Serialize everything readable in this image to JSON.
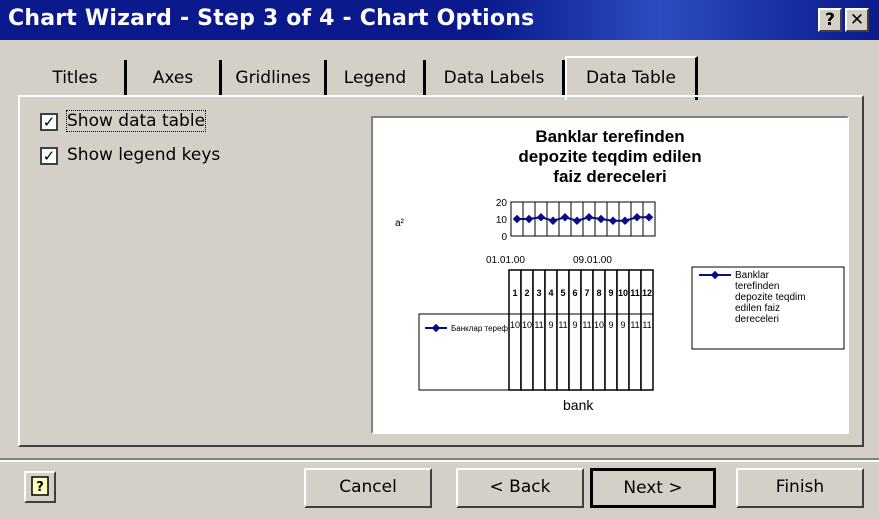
{
  "window": {
    "title": "Chart Wizard - Step 3 of 4 - Chart Options",
    "help_glyph": "?",
    "close_glyph": "✕"
  },
  "tabs": [
    {
      "label": "Titles"
    },
    {
      "label": "Axes"
    },
    {
      "label": "Gridlines"
    },
    {
      "label": "Legend"
    },
    {
      "label": "Data Labels"
    },
    {
      "label": "Data Table"
    }
  ],
  "active_tab": "Data Table",
  "options": {
    "show_data_table": {
      "label": "Show data table",
      "checked": true
    },
    "show_legend_keys": {
      "label": "Show legend keys",
      "checked": true
    }
  },
  "preview": {
    "title_lines": [
      "Banklar terefinden",
      "depozite teqdim edilen",
      "faiz dereceleri"
    ],
    "y_axis_title": "a²",
    "y_ticks": [
      "20",
      "10",
      "0"
    ],
    "x_ticks": [
      "01.01.00",
      "09.01.00"
    ],
    "x_axis_title": "bank",
    "legend_text": "Banklar terefinden depozite teqdim edilen faiz dereceleri",
    "table_headers": [
      "1",
      "2",
      "3",
      "4",
      "5",
      "6",
      "7",
      "8",
      "9",
      "10",
      "11",
      "12"
    ],
    "table_values": [
      "10",
      "10",
      "11",
      "9",
      "11",
      "9",
      "11",
      "10",
      "9",
      "9",
      "11",
      "11"
    ],
    "table_series_label": "Банклар терефинден ...",
    "series_color": "#0b0b8a"
  },
  "chart_data": {
    "type": "line",
    "title": "Banklar terefinden depozite teqdim edilen faiz dereceleri",
    "xlabel": "bank",
    "ylabel": "a²",
    "ylim": [
      0,
      20
    ],
    "x": [
      "1",
      "2",
      "3",
      "4",
      "5",
      "6",
      "7",
      "8",
      "9",
      "10",
      "11",
      "12"
    ],
    "series": [
      {
        "name": "Banklar terefinden depozite teqdim edilen faiz dereceleri",
        "values": [
          10,
          10,
          11,
          9,
          11,
          9,
          11,
          10,
          9,
          9,
          11,
          11
        ]
      }
    ]
  },
  "buttons": {
    "cancel": "Cancel",
    "back": "< Back",
    "next": "Next >",
    "finish": "Finish"
  }
}
